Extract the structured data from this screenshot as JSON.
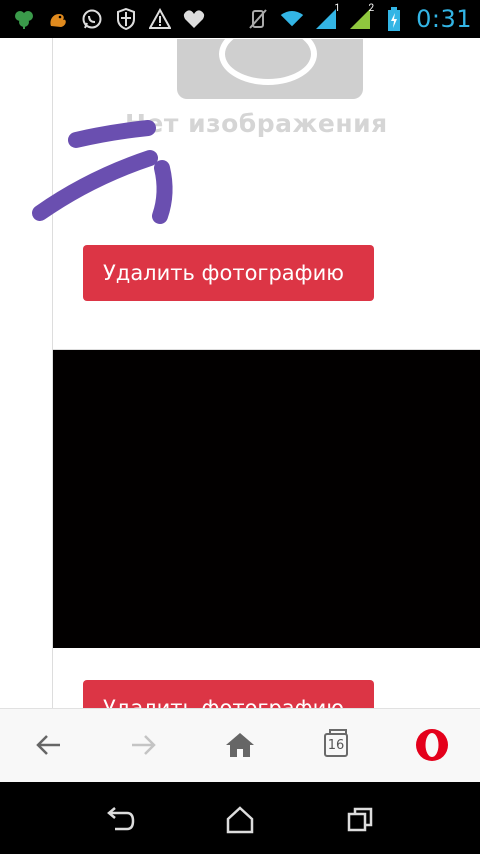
{
  "status_bar": {
    "time": "0:31",
    "signal_1_label": "1",
    "signal_2_label": "2",
    "icons": [
      "leaf-icon",
      "squirrel-icon",
      "whatsapp-icon",
      "shield-icon",
      "warning-icon",
      "heart-icon",
      "mute-icon",
      "wifi-icon",
      "signal-1-icon",
      "signal-2-icon",
      "battery-icon"
    ]
  },
  "content": {
    "no_image_text": "Нет изображения",
    "delete_button_label": "Удалить фотографию",
    "delete_button_label_2": "Удалить фотографию",
    "delete_button_color": "#dc3545"
  },
  "browser_bar": {
    "tabs_count": "16",
    "icons": [
      "back-arrow-icon",
      "forward-arrow-icon",
      "home-icon",
      "tabs-icon",
      "opera-icon"
    ],
    "opera_color": "#e4001b"
  },
  "nav_bar": {
    "icons": [
      "back-icon",
      "home-icon",
      "recent-apps-icon"
    ]
  },
  "annotation": {
    "scribble_color": "#6a4fb0"
  }
}
